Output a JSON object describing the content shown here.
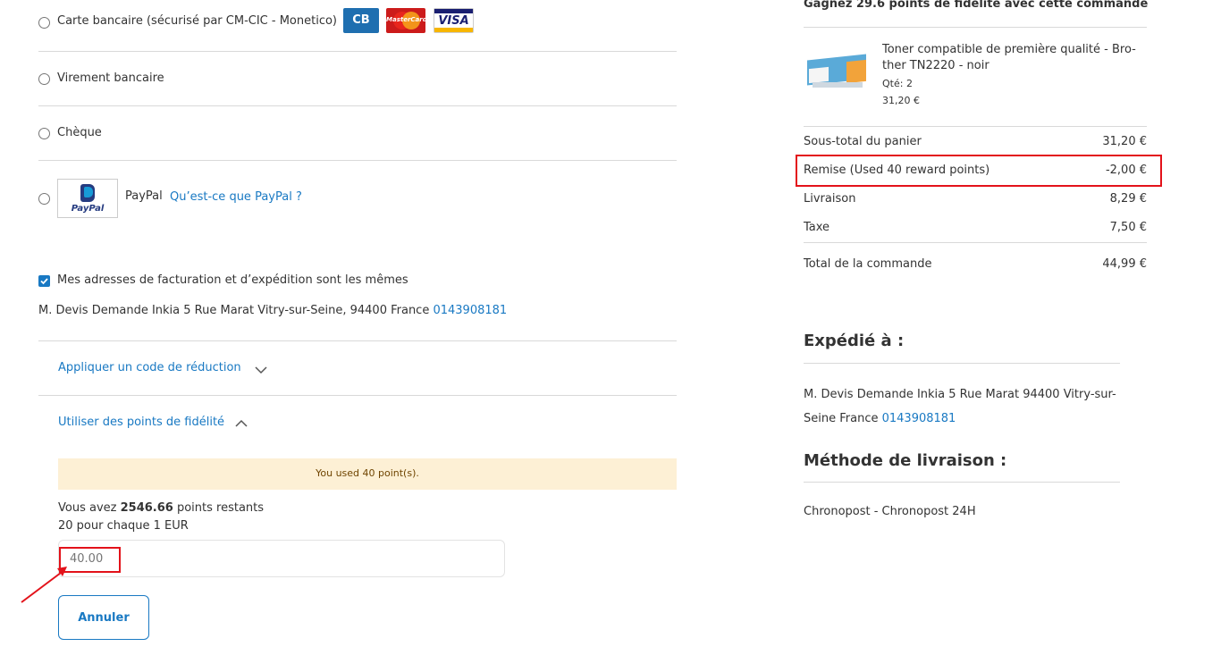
{
  "payment": {
    "cb_label": "Carte bancaire (sécurisé par CM-CIC - Monetico)",
    "cb_logo_text": "CB",
    "mastercard_text": "MasterCard",
    "visa_text": "VISA",
    "transfer_label": "Virement bancaire",
    "cheque_label": "Chèque",
    "paypal_label": "PayPal",
    "paypal_logo_text": "PayPal",
    "paypal_link": "Qu’est-ce que PayPal ?"
  },
  "address": {
    "same_label": "Mes adresses de facturation et d’expédition sont les mêmes",
    "text": "M. Devis Demande Inkia 5 Rue Marat Vitry-sur-Seine, 94400 France",
    "phone": "0143908181"
  },
  "discount": {
    "apply_label": "Appliquer un code de réduction",
    "loyalty_label": "Utiliser des points de fidélité",
    "notice": "You used 40 point(s).",
    "remaining_prefix": "Vous avez",
    "remaining_value": "2546.66",
    "remaining_suffix": "points restants",
    "rate": "20 pour chaque 1 EUR",
    "points_placeholder": "40.00",
    "cancel_label": "Annuler"
  },
  "summary": {
    "header": "Gagnez 29.6 points de fidélité avec cette commande",
    "product_name_line1": "Toner compatible de première qualité - Bro-",
    "product_name_line2": "ther TN2220 - noir",
    "product_qty": "Qté: 2",
    "product_price": "31,20 €",
    "subtotal_label": "Sous-total du panier",
    "subtotal_value": "31,20 €",
    "discount_label": "Remise (Used 40 reward points)",
    "discount_value": "-2,00 €",
    "shipping_label": "Livraison",
    "shipping_value": "8,29 €",
    "tax_label": "Taxe",
    "tax_value": "7,50 €",
    "total_label": "Total de la commande",
    "total_value": "44,99 €"
  },
  "ship_to": {
    "title": "Expédié à :",
    "line1": "M. Devis Demande Inkia 5 Rue Marat 94400 Vitry-sur-",
    "line2": "Seine France",
    "phone": "0143908181"
  },
  "ship_method": {
    "title": "Méthode de livraison :",
    "value": "Chronopost - Chronopost 24H"
  },
  "colors": {
    "accent": "#1979c3",
    "highlight": "#e3121a",
    "notice_bg": "#fdf0d5"
  }
}
